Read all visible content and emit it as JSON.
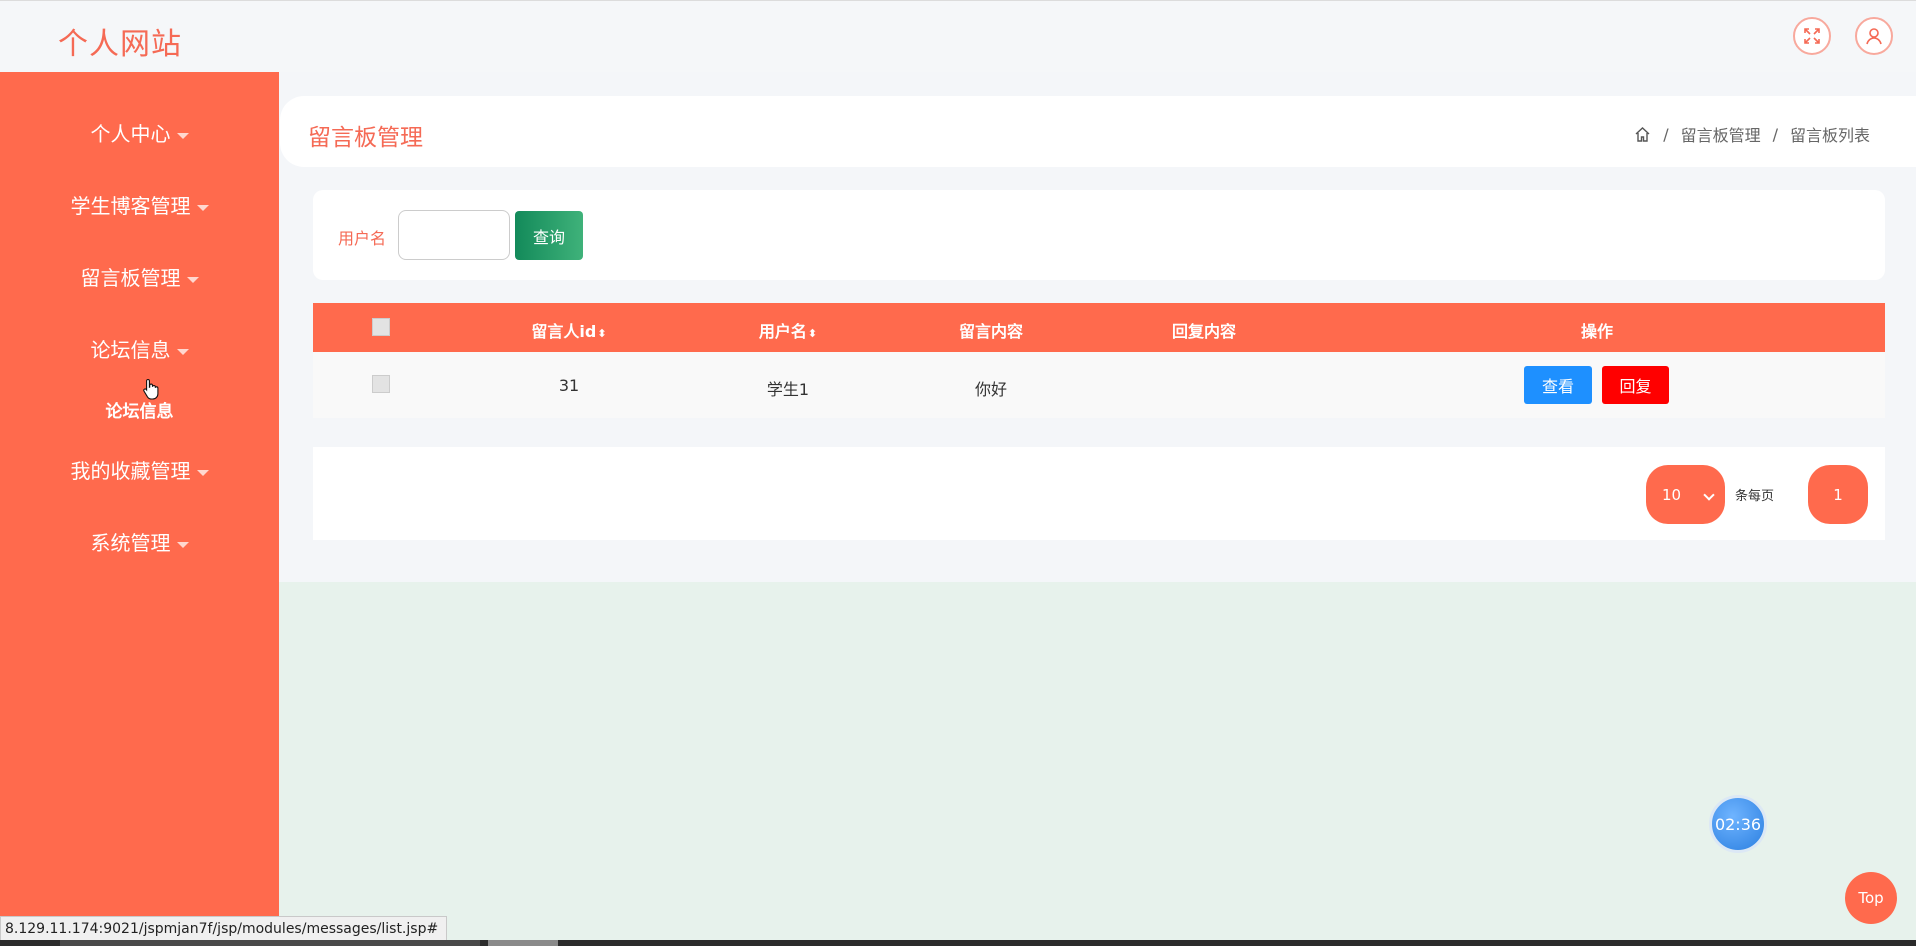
{
  "header": {
    "logo": "个人网站"
  },
  "sidebar": {
    "items": [
      {
        "label": "个人中心"
      },
      {
        "label": "学生博客管理"
      },
      {
        "label": "留言板管理"
      },
      {
        "label": "论坛信息"
      },
      {
        "label": "我的收藏管理"
      },
      {
        "label": "系统管理"
      }
    ],
    "sub_item": "论坛信息"
  },
  "page": {
    "title": "留言板管理",
    "breadcrumb": [
      "留言板管理",
      "留言板列表"
    ],
    "breadcrumb_sep": "/"
  },
  "search": {
    "label": "用户名",
    "value": "",
    "button": "查询"
  },
  "table": {
    "headers": [
      "留言人id",
      "用户名",
      "留言内容",
      "回复内容",
      "操作"
    ],
    "sort_glyph": "⬍",
    "rows": [
      {
        "id": "31",
        "username": "学生1",
        "content": "你好",
        "reply": ""
      }
    ],
    "view_label": "查看",
    "reply_label": "回复"
  },
  "pagination": {
    "page_size": "10",
    "per_page_label": "条每页",
    "current_page": "1"
  },
  "floating": {
    "timer": "02:36",
    "top_label": "Top"
  },
  "status_url": "8.129.11.174:9021/jspmjan7f/jsp/modules/messages/list.jsp#",
  "colors": {
    "accent": "#ff6a4d",
    "view": "#1e90ff",
    "reply": "#ff0000",
    "search": "#138a5a"
  }
}
